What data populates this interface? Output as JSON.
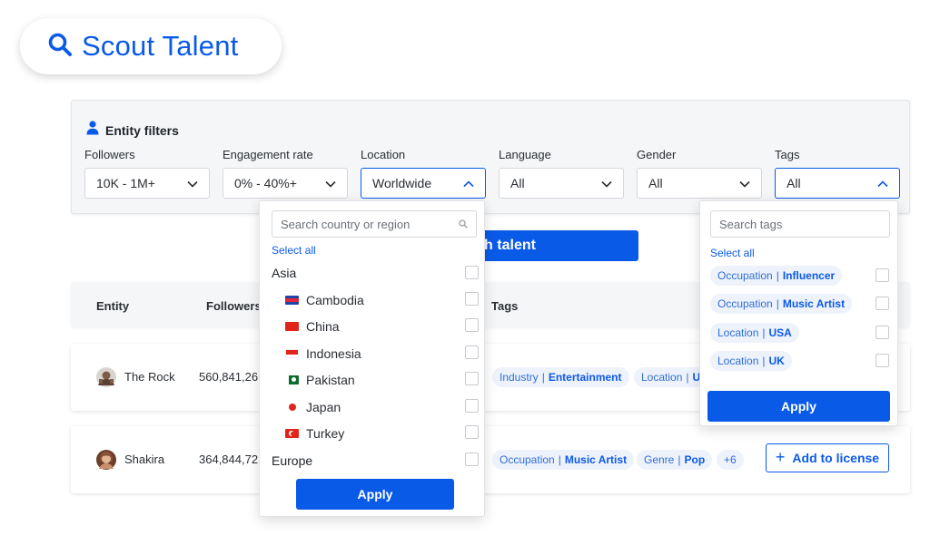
{
  "brand": {
    "title": "Scout Talent",
    "color": "#0a5ae8"
  },
  "filters": {
    "title": "Entity filters",
    "items": [
      {
        "label": "Followers",
        "value": "10K - 1M+"
      },
      {
        "label": "Engagement rate",
        "value": "0% - 40%+"
      },
      {
        "label": "Location",
        "value": "Worldwide"
      },
      {
        "label": "Language",
        "value": "All"
      },
      {
        "label": "Gender",
        "value": "All"
      },
      {
        "label": "Tags",
        "value": "All"
      }
    ]
  },
  "search_button": {
    "label": "h talent"
  },
  "table": {
    "headers": {
      "entity": "Entity",
      "followers": "Followers",
      "tags": "Tags"
    },
    "rows": [
      {
        "name": "The Rock",
        "followers": "560,841,26",
        "tags": [
          {
            "key": "Industry",
            "value": "Entertainment"
          },
          {
            "key": "Location",
            "value": "U"
          }
        ]
      },
      {
        "name": "Shakira",
        "followers": "364,844,72",
        "tags": [
          {
            "key": "Occupation",
            "value": "Music Artist"
          },
          {
            "key": "Genre",
            "value": "Pop"
          }
        ],
        "more": "+6",
        "action": "Add to license",
        "action_icon": "+"
      }
    ]
  },
  "location_dropdown": {
    "search_placeholder": "Search country or region",
    "select_all": "Select all",
    "groups": [
      {
        "name": "Asia"
      },
      {
        "name": "Europe"
      }
    ],
    "countries": [
      "Cambodia",
      "China",
      "Indonesia",
      "Pakistan",
      "Japan",
      "Turkey"
    ],
    "apply": "Apply"
  },
  "tags_dropdown": {
    "search_placeholder": "Search tags",
    "select_all": "Select all",
    "items": [
      {
        "key": "Occupation",
        "value": "Influencer"
      },
      {
        "key": "Occupation",
        "value": "Music Artist"
      },
      {
        "key": "Location",
        "value": "USA"
      },
      {
        "key": "Location",
        "value": "UK"
      }
    ],
    "apply": "Apply"
  },
  "icons": {
    "logo": "search-icon",
    "filters": "user-icon",
    "select": "chevron-icon",
    "dropdown_search": "search-icon"
  }
}
